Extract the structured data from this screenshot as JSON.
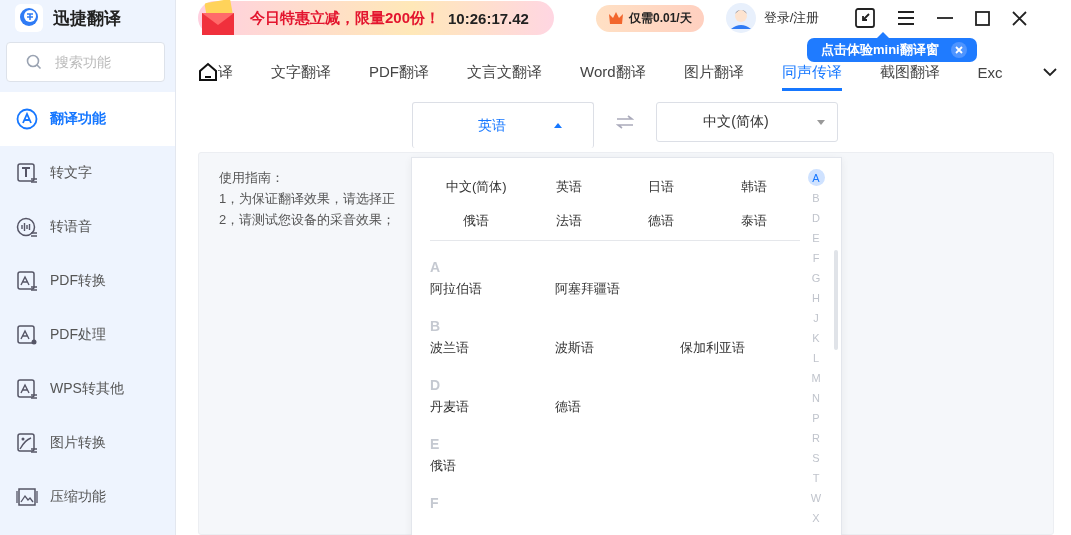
{
  "app": {
    "name": "迅捷翻译"
  },
  "promo": {
    "text": "今日特惠立减，限量200份！",
    "countdown": "10:26:17.42"
  },
  "vip_badge": {
    "text": "仅需0.01/天"
  },
  "user": {
    "label": "登录/注册"
  },
  "tooltip": {
    "text": "点击体验mini翻译窗"
  },
  "search": {
    "placeholder": "搜索功能"
  },
  "sidebar": {
    "items": [
      {
        "label": "翻译功能",
        "kind": "translate",
        "selected": true
      },
      {
        "label": "转文字",
        "kind": "text",
        "selected": false
      },
      {
        "label": "转语音",
        "kind": "speech",
        "selected": false
      },
      {
        "label": "PDF转换",
        "kind": "pdf",
        "selected": false
      },
      {
        "label": "PDF处理",
        "kind": "pdf-tool",
        "selected": false
      },
      {
        "label": "WPS转其他",
        "kind": "wps",
        "selected": false
      },
      {
        "label": "图片转换",
        "kind": "image",
        "selected": false
      },
      {
        "label": "压缩功能",
        "kind": "compress",
        "selected": false
      }
    ]
  },
  "tabs": [
    {
      "label": "译",
      "selected": false
    },
    {
      "label": "文字翻译",
      "selected": false
    },
    {
      "label": "PDF翻译",
      "selected": false
    },
    {
      "label": "文言文翻译",
      "selected": false
    },
    {
      "label": "Word翻译",
      "selected": false
    },
    {
      "label": "图片翻译",
      "selected": false
    },
    {
      "label": "同声传译",
      "selected": true
    },
    {
      "label": "截图翻译",
      "selected": false
    },
    {
      "label": "Exc",
      "selected": false
    }
  ],
  "lang_bar": {
    "source": {
      "label": "英语",
      "expanded": true
    },
    "target": {
      "label": "中文(简体)",
      "expanded": false
    }
  },
  "guide": {
    "title": "使用指南：",
    "lines": [
      "1，为保证翻译效果，请选择正",
      "2，请测试您设备的采音效果；"
    ]
  },
  "dropdown": {
    "popular": [
      "中文(简体)",
      "英语",
      "日语",
      "韩语",
      "俄语",
      "法语",
      "德语",
      "泰语"
    ],
    "sections": [
      {
        "letter": "A",
        "languages": [
          "阿拉伯语",
          "阿塞拜疆语"
        ]
      },
      {
        "letter": "B",
        "languages": [
          "波兰语",
          "波斯语",
          "保加利亚语"
        ]
      },
      {
        "letter": "D",
        "languages": [
          "丹麦语",
          "德语"
        ]
      },
      {
        "letter": "E",
        "languages": [
          "俄语"
        ]
      },
      {
        "letter": "F"
      }
    ],
    "index": [
      {
        "letter": "A",
        "selected": true
      },
      {
        "letter": "B",
        "selected": false
      },
      {
        "letter": "D",
        "selected": false
      },
      {
        "letter": "E",
        "selected": false
      },
      {
        "letter": "F",
        "selected": false
      },
      {
        "letter": "G",
        "selected": false
      },
      {
        "letter": "H",
        "selected": false
      },
      {
        "letter": "J",
        "selected": false
      },
      {
        "letter": "K",
        "selected": false
      },
      {
        "letter": "L",
        "selected": false
      },
      {
        "letter": "M",
        "selected": false
      },
      {
        "letter": "N",
        "selected": false
      },
      {
        "letter": "P",
        "selected": false
      },
      {
        "letter": "R",
        "selected": false
      },
      {
        "letter": "S",
        "selected": false
      },
      {
        "letter": "T",
        "selected": false
      },
      {
        "letter": "W",
        "selected": false
      },
      {
        "letter": "X",
        "selected": false
      }
    ]
  }
}
